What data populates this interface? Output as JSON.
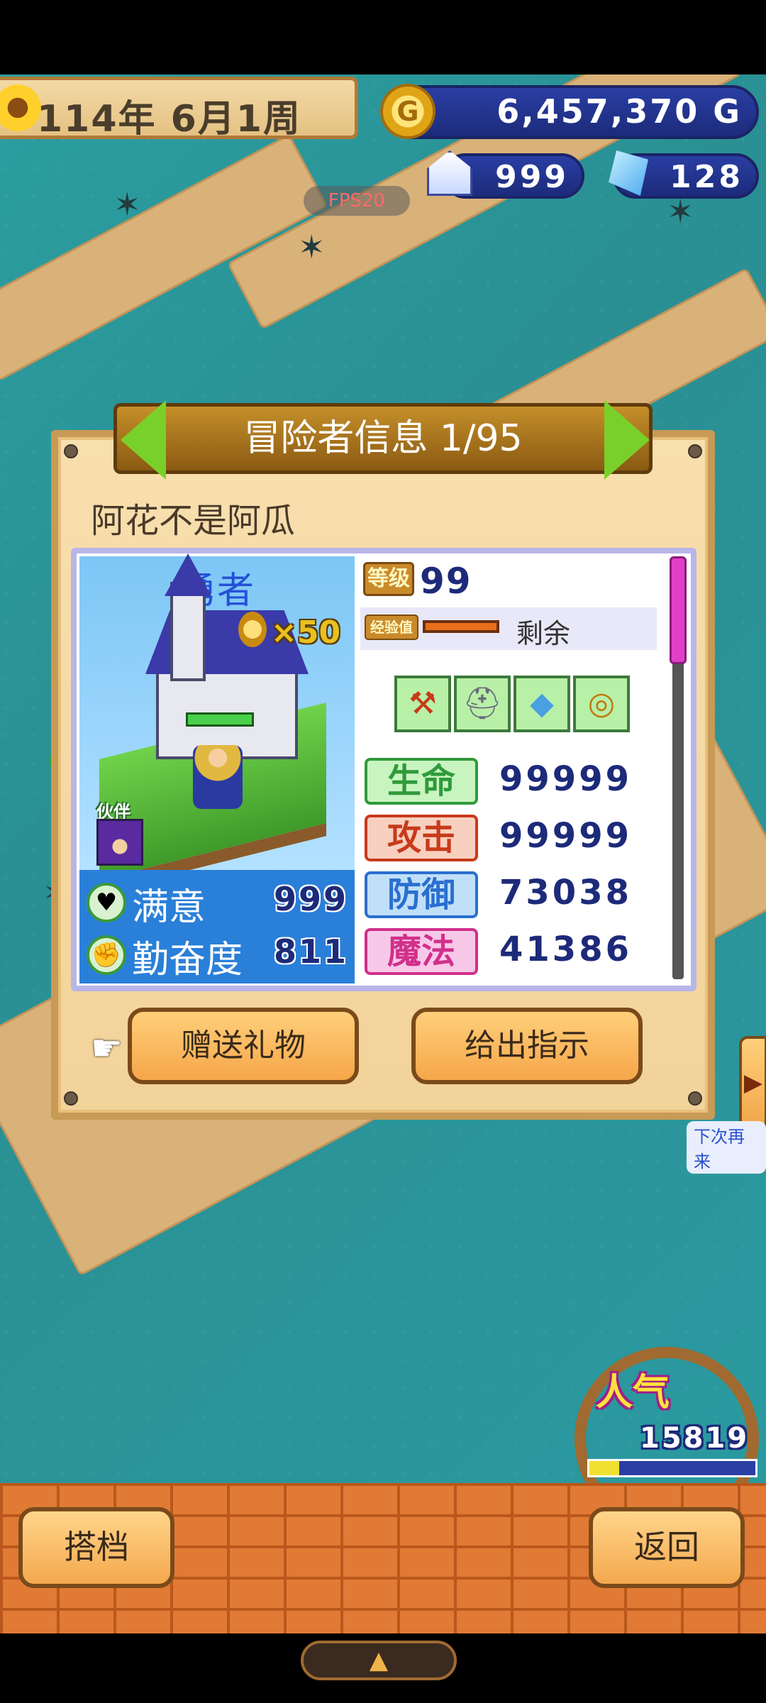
{
  "hud": {
    "date": "114年 6月1周",
    "gold": "6,457,370 G",
    "gold_icon": "G",
    "houses": "999",
    "crystals": "128",
    "fps": "FPS20"
  },
  "dialog": {
    "title": "冒险者信息 1/95",
    "adventurer_name": "阿花不是阿瓜",
    "class_name": "勇者",
    "medal_count": "×50",
    "partner_label": "伙伴",
    "level_badge": "等级",
    "level": "99",
    "exp_badge": "经验值",
    "exp_remaining": "剩余",
    "equipment": [
      "axe-icon",
      "helmet-icon",
      "armor-icon",
      "ring-icon"
    ],
    "mood": [
      {
        "label": "满意",
        "value": "999",
        "icon": "heart-icon"
      },
      {
        "label": "勤奋度",
        "value": "811",
        "icon": "fist-icon"
      }
    ],
    "stats": [
      {
        "label": "生命",
        "value": "99999"
      },
      {
        "label": "攻击",
        "value": "99999"
      },
      {
        "label": "防御",
        "value": "73038"
      },
      {
        "label": "魔法",
        "value": "41386"
      }
    ],
    "buttons": {
      "gift": "赠送礼物",
      "instruct": "给出指示"
    }
  },
  "popularity": {
    "label": "人气",
    "value": "15819"
  },
  "next_label": "下次再来",
  "bottom": {
    "partner": "搭档",
    "back": "返回"
  },
  "colors": {
    "accent_blue": "#1d2a7a",
    "stat_hp": "#2f9a3a",
    "stat_atk": "#c83a1a",
    "stat_def": "#2a6fd0",
    "stat_mag": "#d0308a",
    "bar_orange": "#e07a34"
  }
}
